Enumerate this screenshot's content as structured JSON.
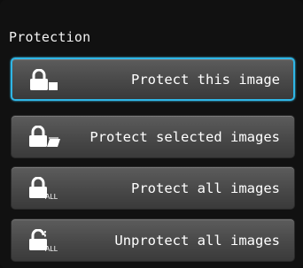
{
  "panel": {
    "title": "Protection",
    "selected_index": 0
  },
  "menu": {
    "items": [
      {
        "label": "Protect this image",
        "icon": "lock-single-icon"
      },
      {
        "label": "Protect selected images",
        "icon": "lock-multiple-icon"
      },
      {
        "label": "Protect all images",
        "icon": "lock-all-icon",
        "icon_text": "ALL"
      },
      {
        "label": "Unprotect all images",
        "icon": "unlock-all-icon",
        "icon_text": "ALL"
      }
    ]
  },
  "colors": {
    "selection_border": "#2fb6e6",
    "text": "#ffffff",
    "background": "#111111"
  }
}
